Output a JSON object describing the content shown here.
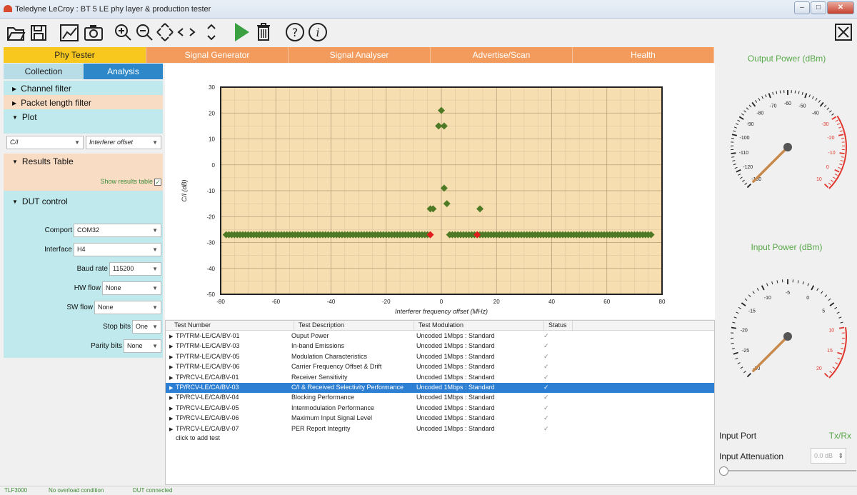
{
  "window": {
    "title": "Teledyne LeCroy : BT 5 LE phy layer & production tester"
  },
  "toolbar": {
    "icons": [
      "open-folder-icon",
      "save-icon",
      "chart-icon",
      "camera-icon",
      "zoom-in-icon",
      "zoom-out-icon",
      "pan-icon",
      "scroll-left-icon",
      "scroll-right-icon",
      "scroll-updown-icon",
      "run-icon",
      "delete-icon",
      "help-icon",
      "info-icon",
      "close-app-icon"
    ]
  },
  "tabs": [
    "Phy Tester",
    "Signal Generator",
    "Signal Analyser",
    "Advertise/Scan",
    "Health"
  ],
  "subtabs": [
    "Collection",
    "Analysis"
  ],
  "left": {
    "channel_filter": "Channel filter",
    "packet_filter": "Packet length filter",
    "plot": "Plot",
    "plot_y": "C/I",
    "plot_x": "Interferer offset",
    "results_table": "Results Table",
    "show_results": "Show results table",
    "dut_control": "DUT control",
    "form": {
      "comport_label": "Comport",
      "comport_value": "COM32",
      "interface_label": "Interface",
      "interface_value": "H4",
      "baud_label": "Baud rate",
      "baud_value": "115200",
      "hw_label": "HW flow",
      "hw_value": "None",
      "sw_label": "SW flow",
      "sw_value": "None",
      "stop_label": "Stop bits",
      "stop_value": "One",
      "parity_label": "Parity bits",
      "parity_value": "None"
    }
  },
  "chart_data": {
    "type": "scatter",
    "xlabel": "Interferer frequency offset (MHz)",
    "ylabel": "C/I (dB)",
    "xlim": [
      -80,
      80
    ],
    "ylim": [
      -50,
      30
    ],
    "xticks": [
      -80,
      -60,
      -40,
      -20,
      0,
      20,
      40,
      60,
      80
    ],
    "yticks": [
      30,
      20,
      10,
      0,
      -10,
      -20,
      -30,
      -40,
      -50
    ],
    "grid": true,
    "series": [
      {
        "color": "#4e7a25",
        "band_left": [
          -78,
          -5
        ],
        "band_right": [
          3,
          76
        ],
        "band_y": -27,
        "x": [
          0,
          -1,
          1,
          -4,
          -3,
          1,
          2,
          14
        ],
        "y": [
          21,
          15,
          15,
          -17,
          -17,
          -9,
          -15,
          -17
        ]
      },
      {
        "color": "#e01c1c",
        "x": [
          -4,
          13
        ],
        "y": [
          -27,
          -27
        ]
      }
    ]
  },
  "table": {
    "headers": [
      "Test Number",
      "Test Description",
      "Test Modulation",
      "Status"
    ],
    "rows": [
      [
        "TP/TRM-LE/CA/BV-01",
        "Ouput Power",
        "Uncoded 1Mbps : Standard",
        "✓"
      ],
      [
        "TP/TRM-LE/CA/BV-03",
        "In-band Emissions",
        "Uncoded 1Mbps : Standard",
        "✓"
      ],
      [
        "TP/TRM-LE/CA/BV-05",
        "Modulation Characteristics",
        "Uncoded 1Mbps : Standard",
        "✓"
      ],
      [
        "TP/TRM-LE/CA/BV-06",
        "Carrier Frequency Offset & Drift",
        "Uncoded 1Mbps : Standard",
        "✓"
      ],
      [
        "TP/RCV-LE/CA/BV-01",
        "Receiver Sensitivity",
        "Uncoded 1Mbps : Standard",
        "✓"
      ],
      [
        "TP/RCV-LE/CA/BV-03",
        "C/I & Received Selectivity Performance",
        "Uncoded 1Mbps : Standard",
        "✓"
      ],
      [
        "TP/RCV-LE/CA/BV-04",
        "Blocking Performance",
        "Uncoded 1Mbps : Standard",
        "✓"
      ],
      [
        "TP/RCV-LE/CA/BV-05",
        "Intermodulation Performance",
        "Uncoded 1Mbps : Standard",
        "✓"
      ],
      [
        "TP/RCV-LE/CA/BV-06",
        "Maximum Input Signal Level",
        "Uncoded 1Mbps : Standard",
        "✓"
      ],
      [
        "TP/RCV-LE/CA/BV-07",
        "PER Report Integrity",
        "Uncoded 1Mbps : Standard",
        "✓"
      ]
    ],
    "add_row": "click to add test",
    "selected_index": 5
  },
  "right": {
    "output_title": "Output Power (dBm)",
    "input_title": "Input Power (dBm)",
    "output_labels": [
      "-130",
      "-120",
      "-110",
      "-100",
      "-90",
      "-80",
      "-70",
      "-60",
      "-50",
      "-40",
      "-30",
      "-20",
      "-10",
      "0",
      "10"
    ],
    "input_labels": [
      "-30",
      "-25",
      "-20",
      "-15",
      "-10",
      "-5",
      "0",
      "5",
      "10",
      "15",
      "20"
    ],
    "output_value": -130,
    "input_value": -30,
    "input_port_label": "Input Port",
    "input_port_value": "Tx/Rx",
    "attenuation_label": "Input Attenuation",
    "attenuation_value": "0.0 dB",
    "accent_red": "#e0362c",
    "accent_green": "#59a84b"
  },
  "status": [
    "TLF3000",
    "No overload condition",
    "DUT connected"
  ]
}
